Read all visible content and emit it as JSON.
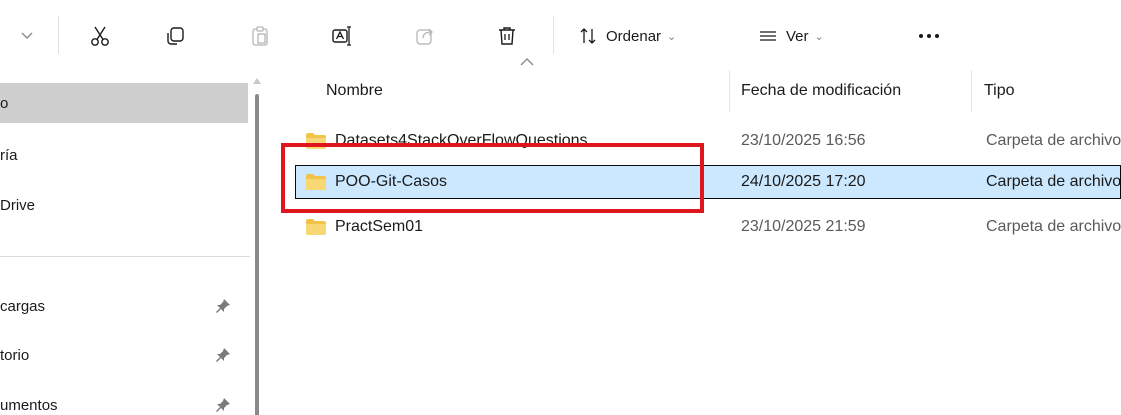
{
  "toolbar": {
    "back_chevron_icon": "chevron-down-icon",
    "cut_icon": "scissors-icon",
    "copy_icon": "copy-icon",
    "paste_icon": "clipboard-icon",
    "rename_icon": "rename-icon",
    "share_icon": "share-icon",
    "delete_icon": "trash-icon",
    "sort_label": "Ordenar",
    "view_label": "Ver",
    "more_label": "···"
  },
  "sidebar": {
    "items": [
      {
        "label": "o",
        "pinned": false,
        "selected": true
      },
      {
        "label": "ría",
        "pinned": false,
        "selected": false
      },
      {
        "label": "Drive",
        "pinned": false,
        "selected": false
      },
      {
        "label": "cargas",
        "pinned": true,
        "selected": false
      },
      {
        "label": "torio",
        "pinned": true,
        "selected": false
      },
      {
        "label": "umentos",
        "pinned": true,
        "selected": false
      }
    ]
  },
  "columns": {
    "name": "Nombre",
    "date": "Fecha de modificación",
    "type": "Tipo"
  },
  "files": [
    {
      "name": "Datasets4StackOverFlowQuestions",
      "date": "23/10/2025 16:56",
      "type": "Carpeta de archivos",
      "selected": false
    },
    {
      "name": "POO-Git-Casos",
      "date": "24/10/2025 17:20",
      "type": "Carpeta de archivos",
      "selected": true
    },
    {
      "name": "PractSem01",
      "date": "23/10/2025 21:59",
      "type": "Carpeta de archivos",
      "selected": false
    }
  ],
  "colors": {
    "selection": "#cce8ff",
    "highlight": "#e0161e",
    "folder": "#f2c34a"
  }
}
